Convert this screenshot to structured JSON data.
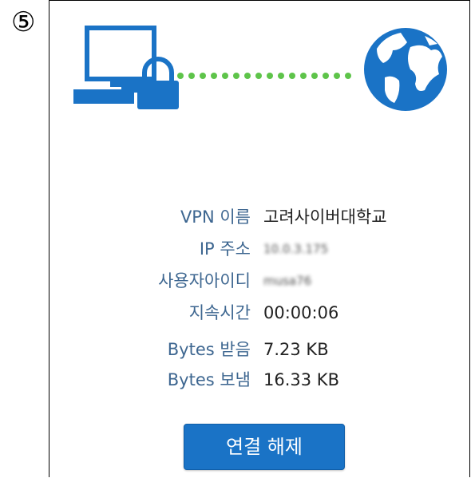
{
  "step_badge": "⑤",
  "colors": {
    "icon_blue": "#1a73c6",
    "dots_green": "#5ec44a",
    "label_blue": "#3d6690",
    "button_blue": "#1a73c6"
  },
  "icons": {
    "computer": "computer-icon",
    "lock": "lock-icon",
    "globe": "globe-icon",
    "connection": "connection-dots"
  },
  "info": {
    "vpn_name_label": "VPN 이름",
    "vpn_name_value": "고려사이버대학교",
    "ip_label": "IP 주소",
    "ip_value": "10.0.3.175",
    "user_label": "사용자아이디",
    "user_value": "musa76",
    "duration_label": "지속시간",
    "duration_value": "00:00:06",
    "bytes_recv_label": "Bytes 받음",
    "bytes_recv_value": "7.23 KB",
    "bytes_sent_label": "Bytes 보냄",
    "bytes_sent_value": "16.33 KB"
  },
  "disconnect_label": "연결 해제"
}
